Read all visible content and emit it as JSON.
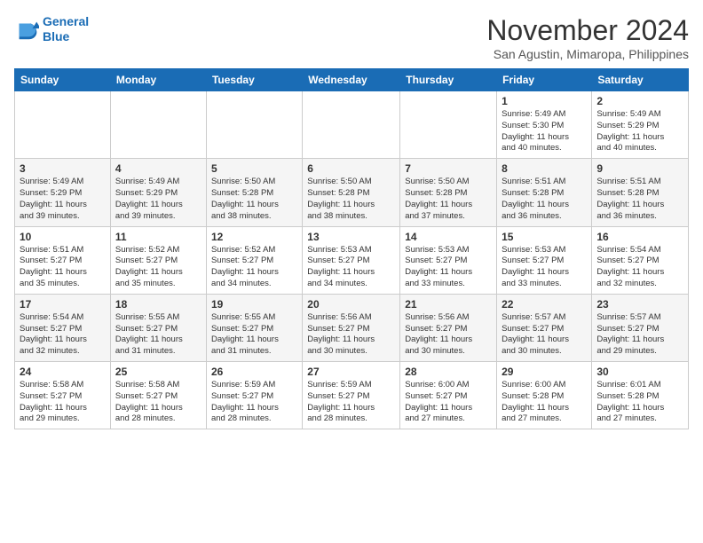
{
  "header": {
    "logo_line1": "General",
    "logo_line2": "Blue",
    "month_title": "November 2024",
    "location": "San Agustin, Mimaropa, Philippines"
  },
  "days_of_week": [
    "Sunday",
    "Monday",
    "Tuesday",
    "Wednesday",
    "Thursday",
    "Friday",
    "Saturday"
  ],
  "weeks": [
    [
      {
        "day": "",
        "info": ""
      },
      {
        "day": "",
        "info": ""
      },
      {
        "day": "",
        "info": ""
      },
      {
        "day": "",
        "info": ""
      },
      {
        "day": "",
        "info": ""
      },
      {
        "day": "1",
        "info": "Sunrise: 5:49 AM\nSunset: 5:30 PM\nDaylight: 11 hours\nand 40 minutes."
      },
      {
        "day": "2",
        "info": "Sunrise: 5:49 AM\nSunset: 5:29 PM\nDaylight: 11 hours\nand 40 minutes."
      }
    ],
    [
      {
        "day": "3",
        "info": "Sunrise: 5:49 AM\nSunset: 5:29 PM\nDaylight: 11 hours\nand 39 minutes."
      },
      {
        "day": "4",
        "info": "Sunrise: 5:49 AM\nSunset: 5:29 PM\nDaylight: 11 hours\nand 39 minutes."
      },
      {
        "day": "5",
        "info": "Sunrise: 5:50 AM\nSunset: 5:28 PM\nDaylight: 11 hours\nand 38 minutes."
      },
      {
        "day": "6",
        "info": "Sunrise: 5:50 AM\nSunset: 5:28 PM\nDaylight: 11 hours\nand 38 minutes."
      },
      {
        "day": "7",
        "info": "Sunrise: 5:50 AM\nSunset: 5:28 PM\nDaylight: 11 hours\nand 37 minutes."
      },
      {
        "day": "8",
        "info": "Sunrise: 5:51 AM\nSunset: 5:28 PM\nDaylight: 11 hours\nand 36 minutes."
      },
      {
        "day": "9",
        "info": "Sunrise: 5:51 AM\nSunset: 5:28 PM\nDaylight: 11 hours\nand 36 minutes."
      }
    ],
    [
      {
        "day": "10",
        "info": "Sunrise: 5:51 AM\nSunset: 5:27 PM\nDaylight: 11 hours\nand 35 minutes."
      },
      {
        "day": "11",
        "info": "Sunrise: 5:52 AM\nSunset: 5:27 PM\nDaylight: 11 hours\nand 35 minutes."
      },
      {
        "day": "12",
        "info": "Sunrise: 5:52 AM\nSunset: 5:27 PM\nDaylight: 11 hours\nand 34 minutes."
      },
      {
        "day": "13",
        "info": "Sunrise: 5:53 AM\nSunset: 5:27 PM\nDaylight: 11 hours\nand 34 minutes."
      },
      {
        "day": "14",
        "info": "Sunrise: 5:53 AM\nSunset: 5:27 PM\nDaylight: 11 hours\nand 33 minutes."
      },
      {
        "day": "15",
        "info": "Sunrise: 5:53 AM\nSunset: 5:27 PM\nDaylight: 11 hours\nand 33 minutes."
      },
      {
        "day": "16",
        "info": "Sunrise: 5:54 AM\nSunset: 5:27 PM\nDaylight: 11 hours\nand 32 minutes."
      }
    ],
    [
      {
        "day": "17",
        "info": "Sunrise: 5:54 AM\nSunset: 5:27 PM\nDaylight: 11 hours\nand 32 minutes."
      },
      {
        "day": "18",
        "info": "Sunrise: 5:55 AM\nSunset: 5:27 PM\nDaylight: 11 hours\nand 31 minutes."
      },
      {
        "day": "19",
        "info": "Sunrise: 5:55 AM\nSunset: 5:27 PM\nDaylight: 11 hours\nand 31 minutes."
      },
      {
        "day": "20",
        "info": "Sunrise: 5:56 AM\nSunset: 5:27 PM\nDaylight: 11 hours\nand 30 minutes."
      },
      {
        "day": "21",
        "info": "Sunrise: 5:56 AM\nSunset: 5:27 PM\nDaylight: 11 hours\nand 30 minutes."
      },
      {
        "day": "22",
        "info": "Sunrise: 5:57 AM\nSunset: 5:27 PM\nDaylight: 11 hours\nand 30 minutes."
      },
      {
        "day": "23",
        "info": "Sunrise: 5:57 AM\nSunset: 5:27 PM\nDaylight: 11 hours\nand 29 minutes."
      }
    ],
    [
      {
        "day": "24",
        "info": "Sunrise: 5:58 AM\nSunset: 5:27 PM\nDaylight: 11 hours\nand 29 minutes."
      },
      {
        "day": "25",
        "info": "Sunrise: 5:58 AM\nSunset: 5:27 PM\nDaylight: 11 hours\nand 28 minutes."
      },
      {
        "day": "26",
        "info": "Sunrise: 5:59 AM\nSunset: 5:27 PM\nDaylight: 11 hours\nand 28 minutes."
      },
      {
        "day": "27",
        "info": "Sunrise: 5:59 AM\nSunset: 5:27 PM\nDaylight: 11 hours\nand 28 minutes."
      },
      {
        "day": "28",
        "info": "Sunrise: 6:00 AM\nSunset: 5:27 PM\nDaylight: 11 hours\nand 27 minutes."
      },
      {
        "day": "29",
        "info": "Sunrise: 6:00 AM\nSunset: 5:28 PM\nDaylight: 11 hours\nand 27 minutes."
      },
      {
        "day": "30",
        "info": "Sunrise: 6:01 AM\nSunset: 5:28 PM\nDaylight: 11 hours\nand 27 minutes."
      }
    ]
  ]
}
